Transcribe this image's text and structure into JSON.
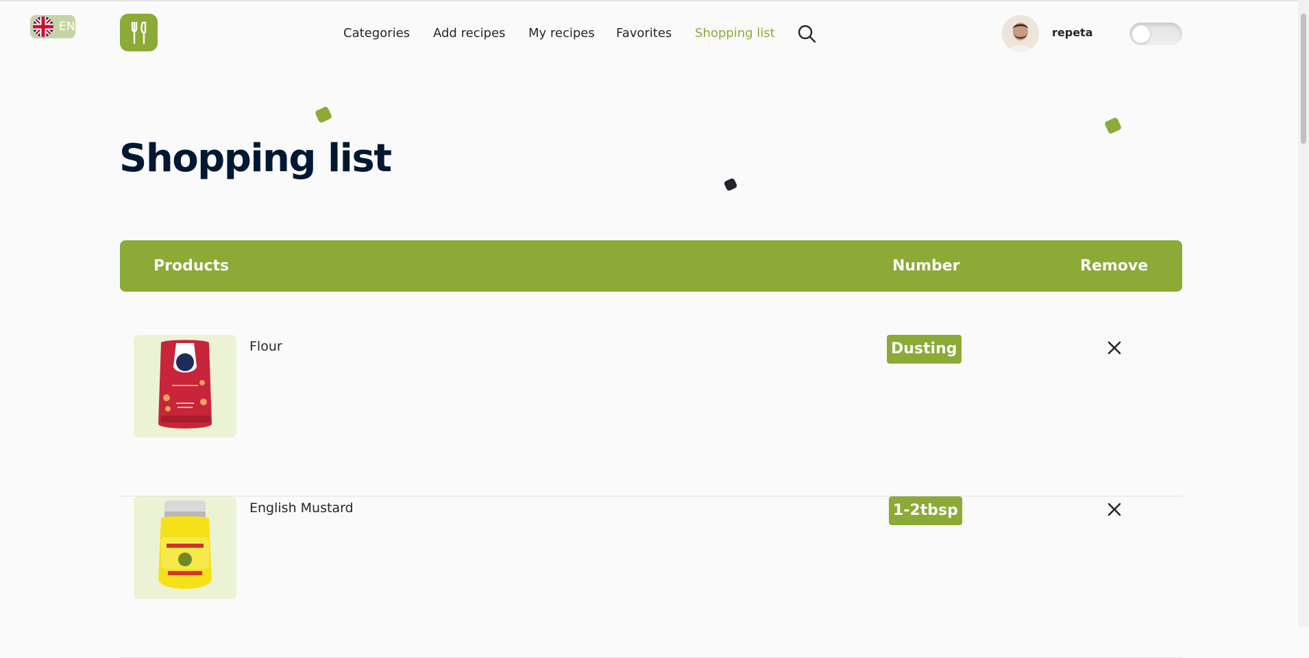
{
  "language": {
    "code": "EN",
    "flag_icon": "uk-flag-icon"
  },
  "logo": {
    "icon": "fork-knife-icon",
    "color": "#8baa36"
  },
  "nav": {
    "items": [
      {
        "label": "Categories"
      },
      {
        "label": "Add recipes"
      },
      {
        "label": "My recipes"
      },
      {
        "label": "Favorites"
      },
      {
        "label": "Shopping list",
        "active": true
      }
    ],
    "search_icon": "search-icon"
  },
  "user": {
    "name": "repeta",
    "theme_toggle": "off"
  },
  "page": {
    "title": "Shopping list"
  },
  "table": {
    "headers": {
      "products": "Products",
      "number": "Number",
      "remove": "Remove"
    },
    "rows": [
      {
        "name": "Flour",
        "quantity": "Dusting",
        "image": "flour-pack-image"
      },
      {
        "name": "English Mustard",
        "quantity": "1-2tbsp",
        "image": "mustard-jar-image"
      }
    ]
  },
  "colors": {
    "accent": "#8baa36",
    "title": "#001833",
    "background": "#fafafa"
  }
}
